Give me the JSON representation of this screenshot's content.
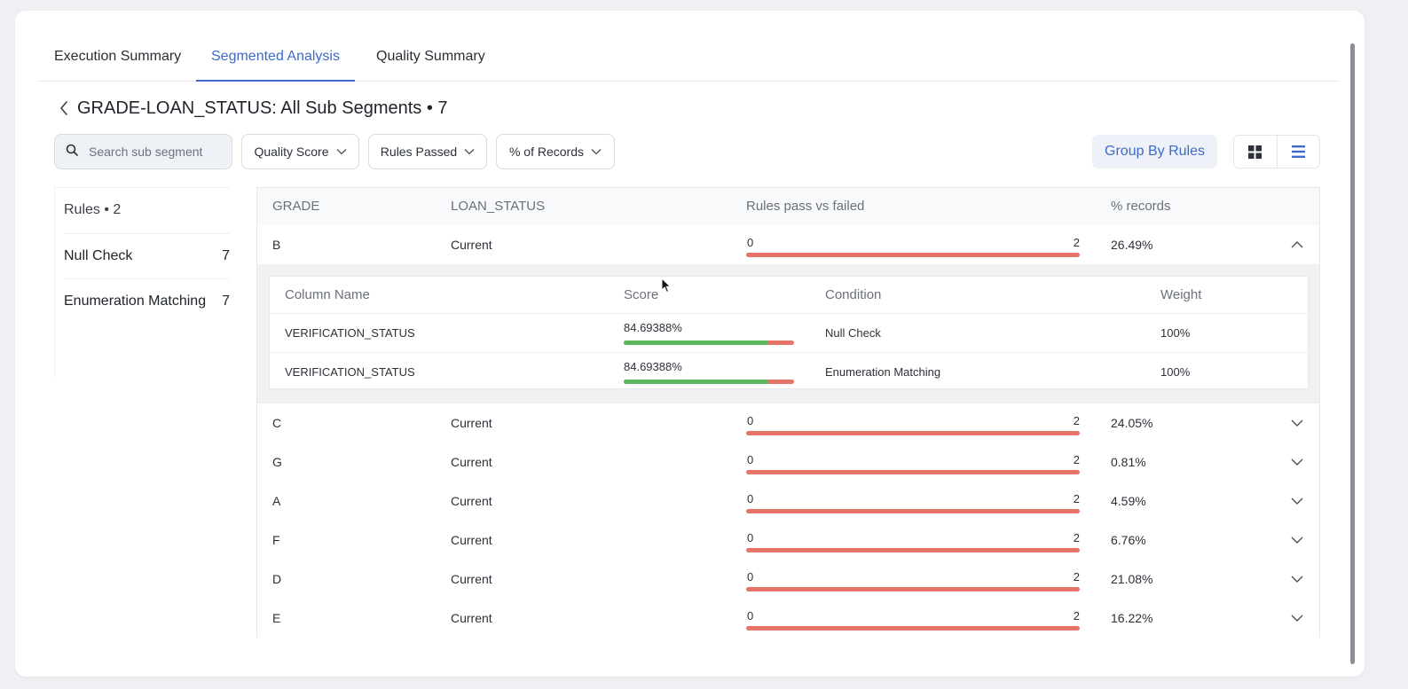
{
  "tabs": [
    {
      "label": "Execution Summary",
      "active": false
    },
    {
      "label": "Segmented Analysis",
      "active": true
    },
    {
      "label": "Quality Summary",
      "active": false
    }
  ],
  "header": {
    "title": "GRADE-LOAN_STATUS: All Sub Segments • 7"
  },
  "search": {
    "placeholder": "Search sub segment",
    "value": ""
  },
  "filters": [
    "Quality Score",
    "Rules Passed",
    "% of Records"
  ],
  "group_by_label": "Group By Rules",
  "rules_panel": {
    "heading": "Rules • 2",
    "items": [
      {
        "label": "Null Check",
        "count": "7"
      },
      {
        "label": "Enumeration Matching",
        "count": "7"
      }
    ]
  },
  "table": {
    "columns": [
      "GRADE",
      "LOAN_STATUS",
      "Rules pass vs failed",
      "% records"
    ],
    "rows": [
      {
        "grade": "B",
        "status": "Current",
        "passed": "0",
        "total": "2",
        "records": "26.49%",
        "expanded": true
      },
      {
        "grade": "C",
        "status": "Current",
        "passed": "0",
        "total": "2",
        "records": "24.05%"
      },
      {
        "grade": "G",
        "status": "Current",
        "passed": "0",
        "total": "2",
        "records": "0.81%"
      },
      {
        "grade": "A",
        "status": "Current",
        "passed": "0",
        "total": "2",
        "records": "4.59%"
      },
      {
        "grade": "F",
        "status": "Current",
        "passed": "0",
        "total": "2",
        "records": "6.76%"
      },
      {
        "grade": "D",
        "status": "Current",
        "passed": "0",
        "total": "2",
        "records": "21.08%"
      },
      {
        "grade": "E",
        "status": "Current",
        "passed": "0",
        "total": "2",
        "records": "16.22%"
      }
    ]
  },
  "detail": {
    "columns": [
      "Column Name",
      "Score",
      "Condition",
      "Weight"
    ],
    "rows": [
      {
        "column": "VERIFICATION_STATUS",
        "score": "84.69388%",
        "score_fraction": 0.8469,
        "condition": "Null Check",
        "weight": "100%"
      },
      {
        "column": "VERIFICATION_STATUS",
        "score": "84.69388%",
        "score_fraction": 0.8469,
        "condition": "Enumeration Matching",
        "weight": "100%"
      }
    ]
  },
  "colors": {
    "accent": "#3d6bc7",
    "fail": "#e57368",
    "pass": "#5cb85c"
  }
}
